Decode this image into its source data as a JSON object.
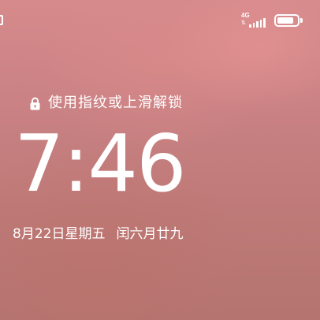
{
  "status_bar": {
    "network_label": "4G",
    "network_activity_icon": "up-down-arrows-icon",
    "signal_icon": "cellular-signal-icon",
    "signal_level": 5,
    "battery_icon": "battery-icon",
    "battery_level_percent": 85
  },
  "lock_screen": {
    "lock_icon": "lock-icon",
    "unlock_hint": "使用指纹或上滑解锁",
    "time": "7:46",
    "date": "8月22日星期五",
    "lunar_date": "闰六月廿九"
  },
  "colors": {
    "text": "#ffffff",
    "wallpaper_top": "#d68a8c",
    "wallpaper_bottom": "#b57470"
  }
}
